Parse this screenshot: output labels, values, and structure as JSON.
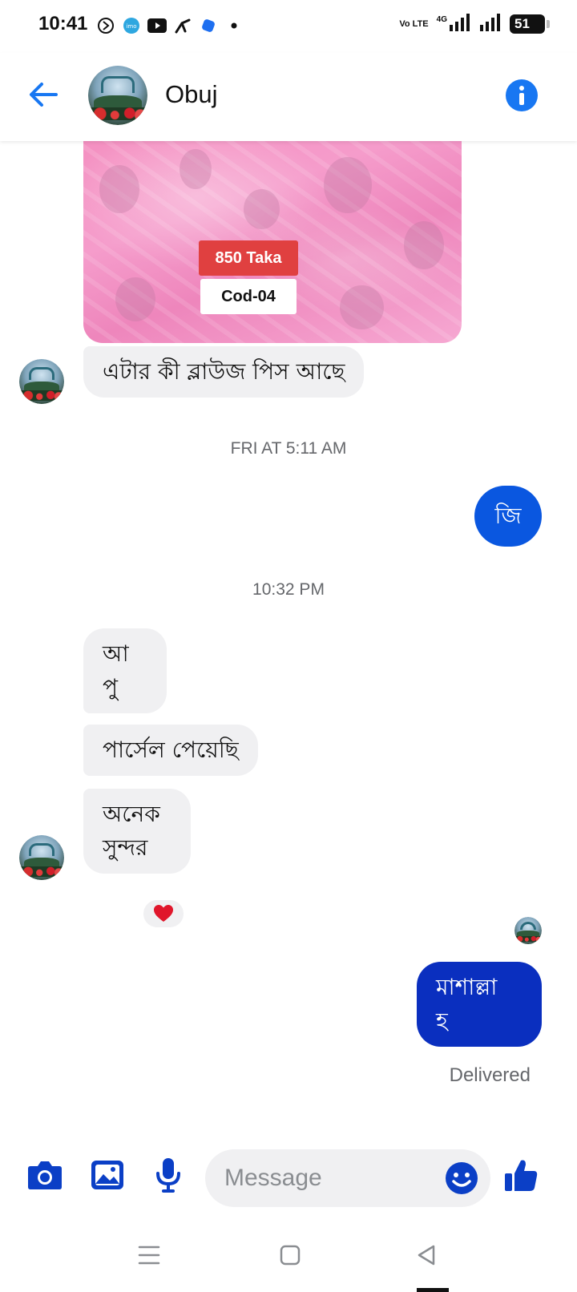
{
  "status_bar": {
    "time": "10:41",
    "network_label": "Vo LTE",
    "network_gen": "4G",
    "battery": "51"
  },
  "header": {
    "contact_name": "Obuj"
  },
  "shared_image": {
    "price_tag": "850 Taka",
    "code_tag": "Cod-04"
  },
  "messages": [
    {
      "id": "m1",
      "direction": "incoming",
      "text": "এটার কী ব্লাউজ  পিস আছে"
    },
    {
      "id": "s1",
      "type": "timestamp",
      "text": "FRI AT 5:11 AM"
    },
    {
      "id": "m2",
      "direction": "outgoing",
      "text": "জি"
    },
    {
      "id": "s2",
      "type": "timestamp",
      "text": "10:32 PM"
    },
    {
      "id": "m3",
      "direction": "incoming",
      "line1": "আ",
      "line2": "পু"
    },
    {
      "id": "m4",
      "direction": "incoming",
      "text": "পার্সেল পেয়েছি"
    },
    {
      "id": "m5",
      "direction": "incoming",
      "line1": "অনেক",
      "line2": "সুন্দর",
      "reaction": "heart"
    },
    {
      "id": "m6",
      "direction": "outgoing",
      "line1": "মাশাল্লা",
      "line2": "হ",
      "status": "Delivered"
    }
  ],
  "composer": {
    "placeholder": "Message"
  },
  "colors": {
    "accent": "#1877f2",
    "outgoing_bubble_1": "#0a57e0",
    "outgoing_bubble_2": "#0a2fbf",
    "incoming_bubble": "#f0f0f2",
    "composer_icons": "#0b3fc6"
  }
}
